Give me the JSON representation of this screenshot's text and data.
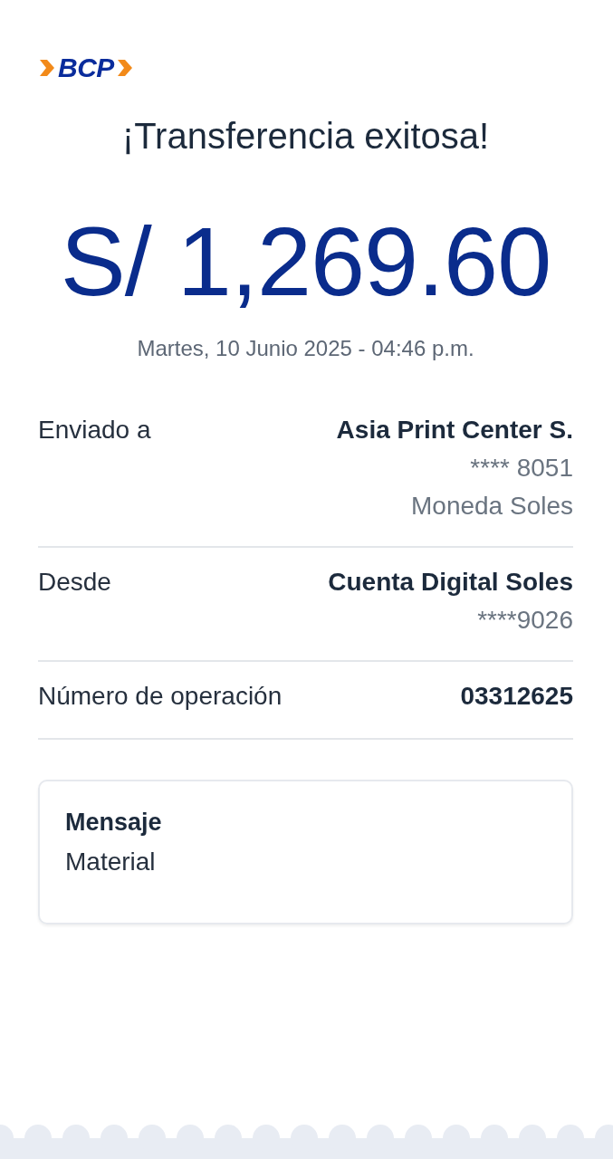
{
  "logo": {
    "text": "BCP"
  },
  "title": "¡Transferencia exitosa!",
  "amount": "S/ 1,269.60",
  "datetime": "Martes, 10 Junio 2025 - 04:46 p.m.",
  "details": [
    {
      "label": "Enviado a",
      "values": [
        "Asia Print Center S.",
        "**** 8051",
        "Moneda Soles"
      ]
    },
    {
      "label": "Desde",
      "values": [
        "Cuenta Digital Soles",
        "****9026"
      ]
    },
    {
      "label": "Número de operación",
      "values": [
        "03312625"
      ]
    }
  ],
  "message": {
    "title": "Mensaje",
    "text": "Material"
  }
}
